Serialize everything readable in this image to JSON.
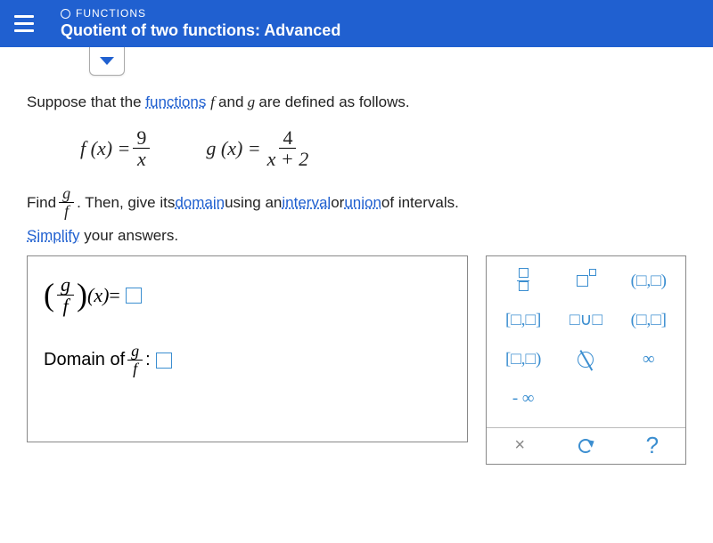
{
  "header": {
    "category": "FUNCTIONS",
    "title": "Quotient of two functions: Advanced"
  },
  "prompt": {
    "line1_pre": "Suppose that the ",
    "functions_link": "functions",
    "line1_post": " f and g are defined as follows.",
    "fx_lhs": "f (x) =",
    "fx_num": "9",
    "fx_den": "x",
    "gx_lhs": "g (x) =",
    "gx_num": "4",
    "gx_den": "x + 2",
    "find_pre": "Find ",
    "gf_num": "g",
    "gf_den": "f",
    "find_mid": ". Then, give its ",
    "domain_link": "domain",
    "find_using": " using an ",
    "interval_link": "interval",
    "find_or": " or ",
    "union_link": "union",
    "find_end": " of intervals.",
    "simplify_link": "Simplify",
    "simplify_end": " your answers."
  },
  "answer": {
    "gf_label_num": "g",
    "gf_label_den": "f",
    "x_label": "(x)",
    "equals": " = ",
    "domain_label": "Domain of ",
    "colon": " :"
  },
  "palette": {
    "open_open": "(□,□)",
    "closed_closed": "[□,□]",
    "union": "□∪□",
    "open_closed": "(□,□]",
    "closed_open": "[□,□)",
    "infinity": "∞",
    "neg_inf": "- ∞",
    "reject": "×",
    "help": "?"
  }
}
